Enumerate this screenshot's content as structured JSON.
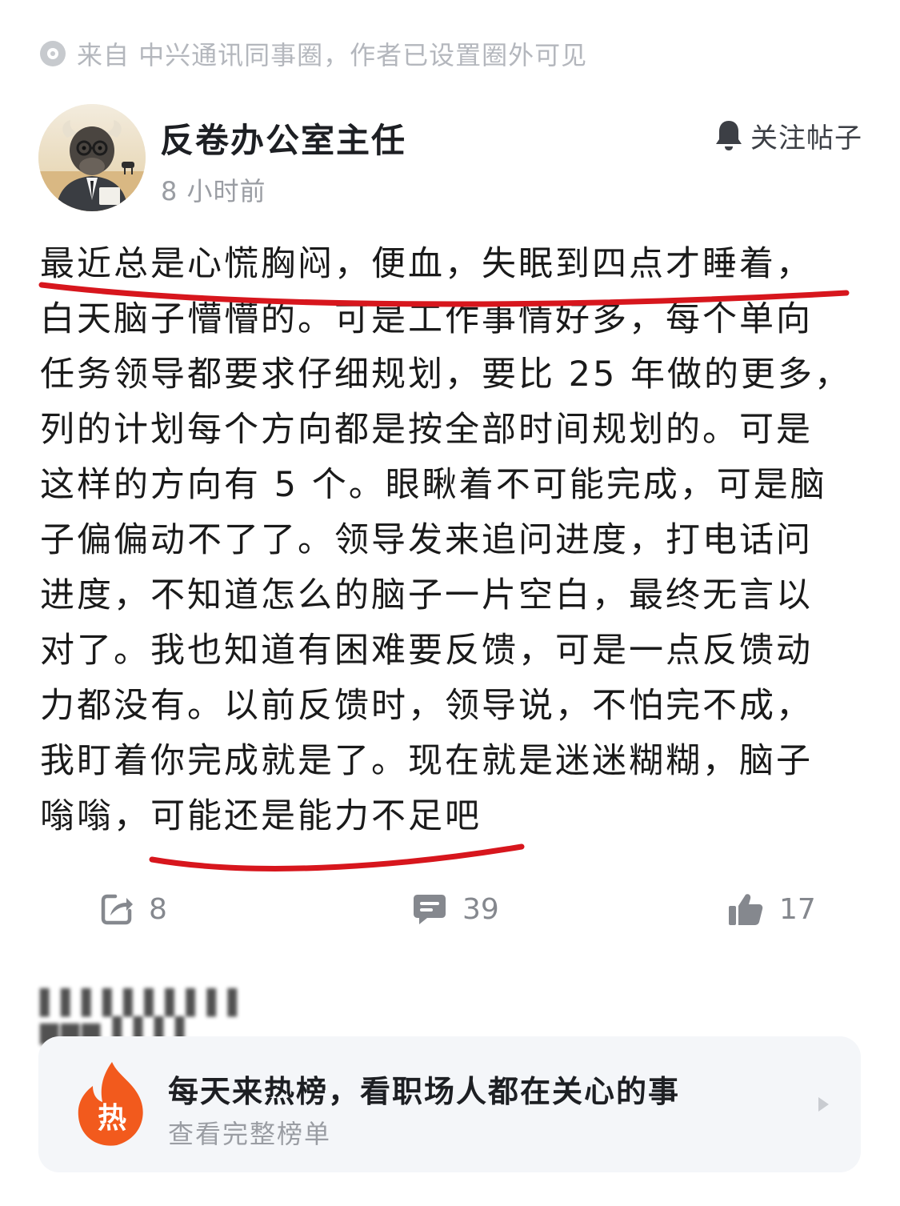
{
  "source": {
    "icon": "circle-dot-icon",
    "text": "来自 中兴通讯同事圈，作者已设置圈外可见"
  },
  "author": {
    "name": "反卷办公室主任",
    "time": "8 小时前",
    "avatar": "bull-in-suit-avatar"
  },
  "follow": {
    "icon": "bell-icon",
    "label": "关注帖子"
  },
  "post": {
    "lines": [
      "最近总是心慌胸闷，便血，失眠到四点才睡着，",
      "白天脑子懵懵的。可是工作事情好多，每个单向",
      "任务领导都要求仔细规划，要比 25 年做的更多，",
      "列的计划每个方向都是按全部时间规划的。可是",
      "这样的方向有 5 个。眼瞅着不可能完成，可是脑",
      "子偏偏动不了了。领导发来追问进度，打电话问",
      "进度，不知道怎么的脑子一片空白，最终无言以",
      "对了。我也知道有困难要反馈，可是一点反馈动",
      "力都没有。以前反馈时，领导说，不怕完不成，",
      "我盯着你完成就是了。现在就是迷迷糊糊，脑子",
      "嗡嗡，可能还是能力不足吧"
    ],
    "underline_color": "#d7161d"
  },
  "stats": {
    "share": {
      "icon": "share-icon",
      "count": "8"
    },
    "comment": {
      "icon": "comment-icon",
      "count": "39"
    },
    "like": {
      "icon": "thumbs-up-icon",
      "count": "17"
    }
  },
  "hot": {
    "badge_icon": "fire-icon",
    "badge_text": "热",
    "title": "每天来热榜，看职场人都在关心的事",
    "subtitle": "查看完整榜单",
    "arrow_icon": "chevron-right-icon"
  },
  "colors": {
    "hot_orange": "#f25a1d",
    "text_gray": "#9a9da3"
  }
}
